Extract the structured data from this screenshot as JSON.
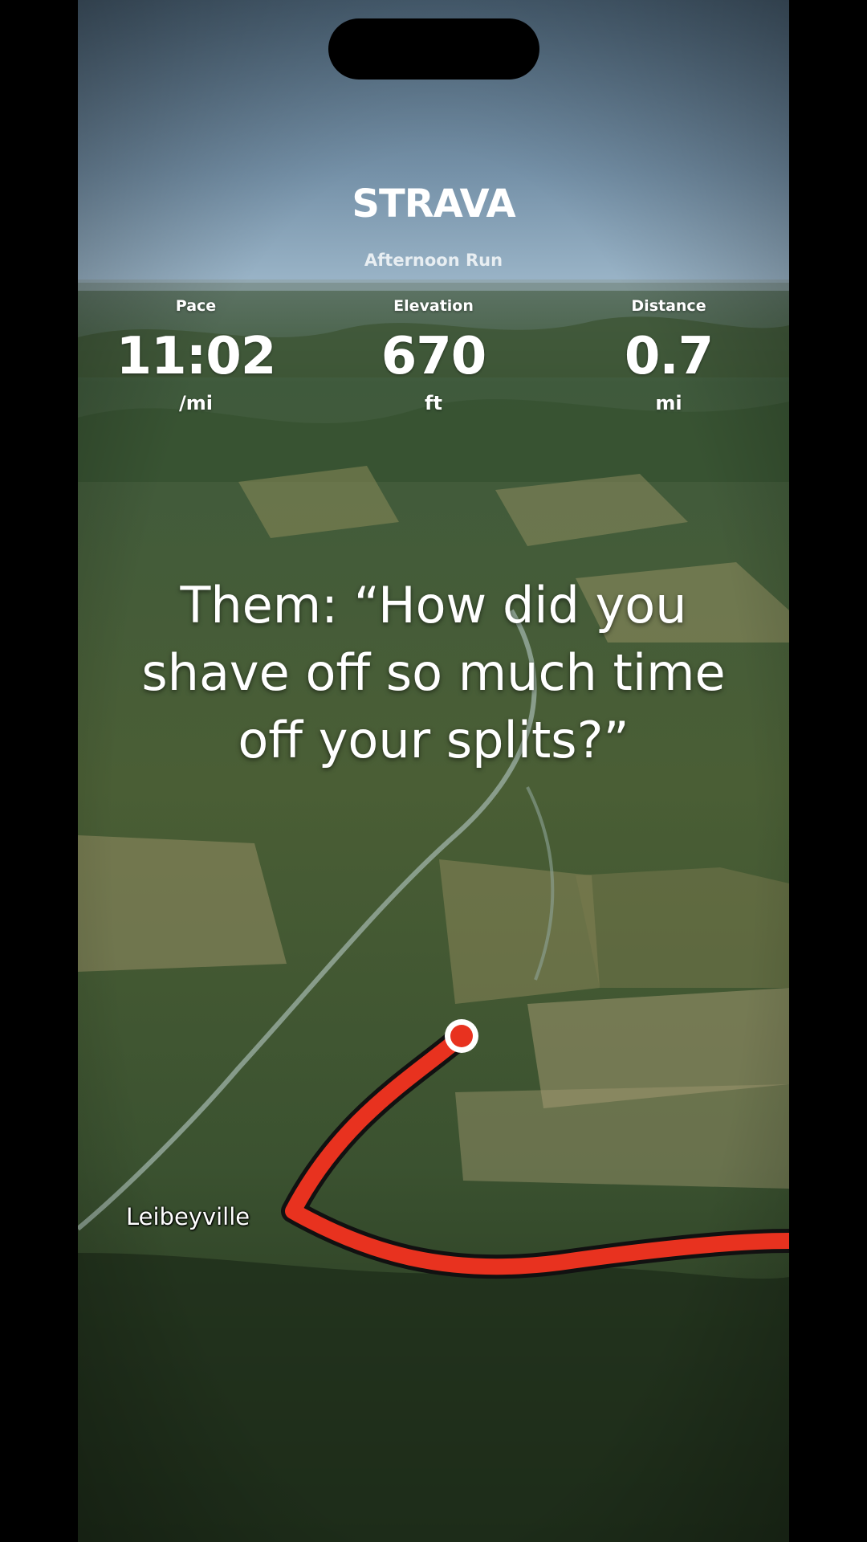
{
  "app": {
    "logo_text": "STRAVA"
  },
  "activity": {
    "title": "Afternoon Run"
  },
  "stats": [
    {
      "label": "Pace",
      "value": "11:02",
      "unit": "/mi"
    },
    {
      "label": "Elevation",
      "value": "670",
      "unit": "ft"
    },
    {
      "label": "Distance",
      "value": "0.7",
      "unit": "mi"
    }
  ],
  "caption": {
    "text": "Them: “How did you\nshave off so much time\noff your splits?”"
  },
  "map": {
    "place_label": "Leibeyville",
    "route_color": "#e8321f",
    "marker_color": "#e8321f"
  },
  "colors": {
    "brand": "#ffffff",
    "sky_top": "#4d6478",
    "sky_bottom": "#93aec4",
    "terrain": "#2f4a2a"
  }
}
